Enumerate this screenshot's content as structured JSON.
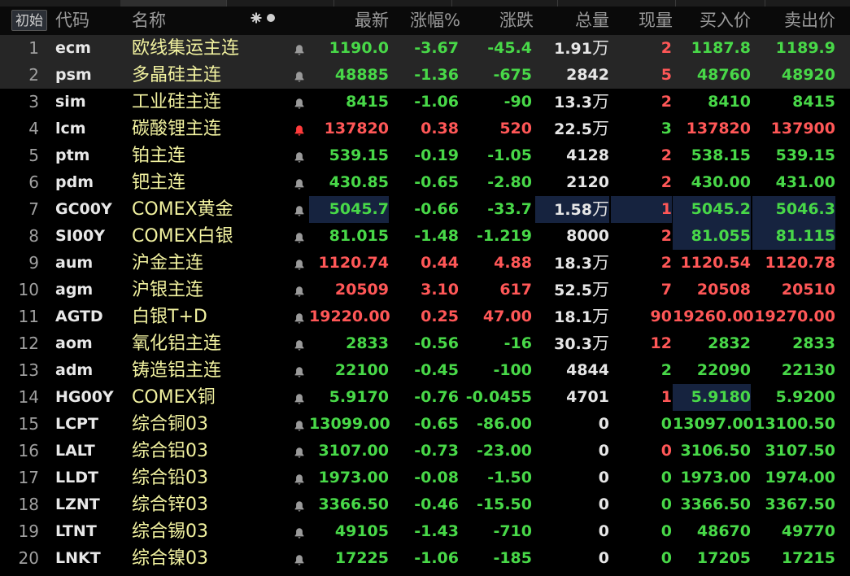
{
  "colors": {
    "up": "#ff5757",
    "down": "#48d848",
    "flat": "#e6e6e6",
    "name": "#f2f2a0",
    "bell_off": "#9a9a9a",
    "bell_on": "#ff3b3b",
    "highlight": "#16233f"
  },
  "toolbar": {
    "init_label": "初始",
    "column_settings_icon": "gear-and-dot-icon"
  },
  "columns": {
    "code": "代码",
    "name": "名称",
    "last": "最新",
    "pct": "涨幅%",
    "chg": "涨跌",
    "vol": "总量",
    "cur": "现量",
    "bid": "买入价",
    "ask": "卖出价"
  },
  "rows": [
    {
      "idx": "1",
      "code": "ecm",
      "name": "欧线集运主连",
      "bell": "off",
      "last": "1190.0",
      "pct": "-3.67",
      "chg": "-45.4",
      "vol": "1.91",
      "unit": "万",
      "cur": "2",
      "bid": "1187.8",
      "ask": "1189.9",
      "dir": "down",
      "cur_dir": "up",
      "sel": true
    },
    {
      "idx": "2",
      "code": "psm",
      "name": "多晶硅主连",
      "bell": "off",
      "last": "48885",
      "pct": "-1.36",
      "chg": "-675",
      "vol": "2842",
      "unit": "",
      "cur": "5",
      "bid": "48760",
      "ask": "48920",
      "dir": "down",
      "cur_dir": "up",
      "sel": true
    },
    {
      "idx": "3",
      "code": "sim",
      "name": "工业硅主连",
      "bell": "off",
      "last": "8415",
      "pct": "-1.06",
      "chg": "-90",
      "vol": "13.3",
      "unit": "万",
      "cur": "2",
      "bid": "8410",
      "ask": "8415",
      "dir": "down",
      "cur_dir": "up"
    },
    {
      "idx": "4",
      "code": "lcm",
      "name": "碳酸锂主连",
      "bell": "on",
      "last": "137820",
      "pct": "0.38",
      "chg": "520",
      "vol": "22.5",
      "unit": "万",
      "cur": "3",
      "bid": "137820",
      "ask": "137900",
      "dir": "up",
      "cur_dir": "down"
    },
    {
      "idx": "5",
      "code": "ptm",
      "name": "铂主连",
      "bell": "off",
      "last": "539.15",
      "pct": "-0.19",
      "chg": "-1.05",
      "vol": "4128",
      "unit": "",
      "cur": "2",
      "bid": "538.15",
      "ask": "539.15",
      "dir": "down",
      "cur_dir": "up"
    },
    {
      "idx": "6",
      "code": "pdm",
      "name": "钯主连",
      "bell": "off",
      "last": "430.85",
      "pct": "-0.65",
      "chg": "-2.80",
      "vol": "2120",
      "unit": "",
      "cur": "2",
      "bid": "430.00",
      "ask": "431.00",
      "dir": "down",
      "cur_dir": "up"
    },
    {
      "idx": "7",
      "code": "GC00Y",
      "name": "COMEX黄金",
      "bell": "off",
      "last": "5045.7",
      "pct": "-0.66",
      "chg": "-33.7",
      "vol": "1.58",
      "unit": "万",
      "cur": "1",
      "bid": "5045.2",
      "ask": "5046.3",
      "dir": "down",
      "cur_dir": "up",
      "hl": [
        "last",
        "vol",
        "cur",
        "bid",
        "ask"
      ]
    },
    {
      "idx": "8",
      "code": "SI00Y",
      "name": "COMEX白银",
      "bell": "off",
      "last": "81.015",
      "pct": "-1.48",
      "chg": "-1.219",
      "vol": "8000",
      "unit": "",
      "cur": "2",
      "bid": "81.055",
      "ask": "81.115",
      "dir": "down",
      "cur_dir": "up",
      "hl": [
        "bid",
        "ask"
      ]
    },
    {
      "idx": "9",
      "code": "aum",
      "name": "沪金主连",
      "bell": "off",
      "last": "1120.74",
      "pct": "0.44",
      "chg": "4.88",
      "vol": "18.3",
      "unit": "万",
      "cur": "2",
      "bid": "1120.54",
      "ask": "1120.78",
      "dir": "up",
      "cur_dir": "up"
    },
    {
      "idx": "10",
      "code": "agm",
      "name": "沪银主连",
      "bell": "off",
      "last": "20509",
      "pct": "3.10",
      "chg": "617",
      "vol": "52.5",
      "unit": "万",
      "cur": "7",
      "bid": "20508",
      "ask": "20510",
      "dir": "up",
      "cur_dir": "up"
    },
    {
      "idx": "11",
      "code": "AGTD",
      "name": "白银T+D",
      "bell": "off",
      "last": "19220.00",
      "pct": "0.25",
      "chg": "47.00",
      "vol": "18.1",
      "unit": "万",
      "cur": "90",
      "bid": "19260.00",
      "ask": "19270.00",
      "dir": "up",
      "cur_dir": "up"
    },
    {
      "idx": "12",
      "code": "aom",
      "name": "氧化铝主连",
      "bell": "off",
      "last": "2833",
      "pct": "-0.56",
      "chg": "-16",
      "vol": "30.3",
      "unit": "万",
      "cur": "12",
      "bid": "2832",
      "ask": "2833",
      "dir": "down",
      "cur_dir": "up"
    },
    {
      "idx": "13",
      "code": "adm",
      "name": "铸造铝主连",
      "bell": "off",
      "last": "22100",
      "pct": "-0.45",
      "chg": "-100",
      "vol": "4844",
      "unit": "",
      "cur": "2",
      "bid": "22090",
      "ask": "22130",
      "dir": "down",
      "cur_dir": "down"
    },
    {
      "idx": "14",
      "code": "HG00Y",
      "name": "COMEX铜",
      "bell": "off",
      "last": "5.9170",
      "pct": "-0.76",
      "chg": "-0.0455",
      "vol": "4701",
      "unit": "",
      "cur": "1",
      "bid": "5.9180",
      "ask": "5.9200",
      "dir": "down",
      "cur_dir": "up",
      "hl": [
        "bid"
      ]
    },
    {
      "idx": "15",
      "code": "LCPT",
      "name": "综合铜03",
      "bell": "off",
      "last": "13099.00",
      "pct": "-0.65",
      "chg": "-86.00",
      "vol": "0",
      "unit": "",
      "cur": "0",
      "bid": "13097.00",
      "ask": "13100.50",
      "dir": "down",
      "cur_dir": "down"
    },
    {
      "idx": "16",
      "code": "LALT",
      "name": "综合铝03",
      "bell": "off",
      "last": "3107.00",
      "pct": "-0.73",
      "chg": "-23.00",
      "vol": "0",
      "unit": "",
      "cur": "0",
      "bid": "3106.50",
      "ask": "3107.50",
      "dir": "down",
      "cur_dir": "up"
    },
    {
      "idx": "17",
      "code": "LLDT",
      "name": "综合铅03",
      "bell": "off",
      "last": "1973.00",
      "pct": "-0.08",
      "chg": "-1.50",
      "vol": "0",
      "unit": "",
      "cur": "0",
      "bid": "1973.00",
      "ask": "1974.00",
      "dir": "down",
      "cur_dir": "down"
    },
    {
      "idx": "18",
      "code": "LZNT",
      "name": "综合锌03",
      "bell": "off",
      "last": "3366.50",
      "pct": "-0.46",
      "chg": "-15.50",
      "vol": "0",
      "unit": "",
      "cur": "0",
      "bid": "3366.50",
      "ask": "3367.50",
      "dir": "down",
      "cur_dir": "down"
    },
    {
      "idx": "19",
      "code": "LTNT",
      "name": "综合锡03",
      "bell": "off",
      "last": "49105",
      "pct": "-1.43",
      "chg": "-710",
      "vol": "0",
      "unit": "",
      "cur": "0",
      "bid": "48670",
      "ask": "49770",
      "dir": "down",
      "cur_dir": "down"
    },
    {
      "idx": "20",
      "code": "LNKT",
      "name": "综合镍03",
      "bell": "off",
      "last": "17225",
      "pct": "-1.06",
      "chg": "-185",
      "vol": "0",
      "unit": "",
      "cur": "0",
      "bid": "17205",
      "ask": "17215",
      "dir": "down",
      "cur_dir": "down"
    }
  ]
}
